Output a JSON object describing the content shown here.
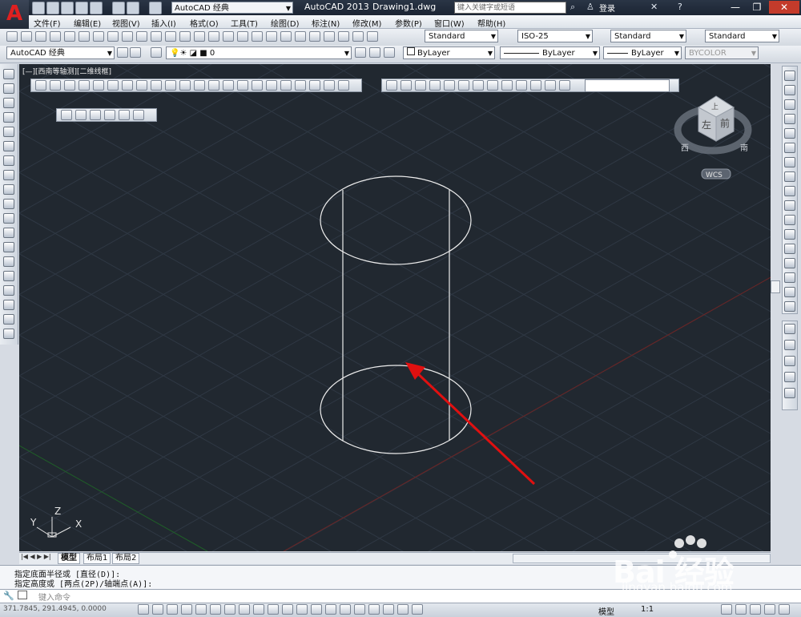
{
  "titlebar": {
    "app_title": "AutoCAD 2013",
    "doc_name": "Drawing1.dwg",
    "workspace": "AutoCAD 经典",
    "search_placeholder": "键入关键字或短语",
    "login": "登录"
  },
  "menu": [
    "文件(F)",
    "编辑(E)",
    "视图(V)",
    "插入(I)",
    "格式(O)",
    "工具(T)",
    "绘图(D)",
    "标注(N)",
    "修改(M)",
    "参数(P)",
    "窗口(W)",
    "帮助(H)"
  ],
  "styles_toolbar": {
    "text_style": "Standard",
    "dim_style": "ISO-25",
    "table_style": "Standard",
    "multileader_style": "Standard"
  },
  "layers_toolbar": {
    "workspace": "AutoCAD 经典",
    "layer": "0",
    "color": "ByLayer",
    "linetype": "ByLayer",
    "lineweight": "ByLayer",
    "plotstyle": "BYCOLOR"
  },
  "viewport": {
    "label": "[—][西南等轴测][二维线框]",
    "viewcube": {
      "top": "上",
      "left": "左",
      "front": "前",
      "south": "南",
      "west": "西"
    },
    "wcs": "WCS",
    "ucs": {
      "x": "X",
      "y": "Y",
      "z": "Z"
    }
  },
  "tabs": [
    "模型",
    "布局1",
    "布局2"
  ],
  "command": {
    "line1": "指定底面半径或 [直径(D)]:",
    "line2": "指定高度或 [两点(2P)/轴端点(A)]:",
    "input_placeholder": "键入命令"
  },
  "status": {
    "coords": "371.7845, 291.4945, 0.0000",
    "model": "模型",
    "scale": "1:1"
  },
  "watermark": {
    "brand": "Bai 经验",
    "url": "jingyan.baidu.com"
  },
  "colors": {
    "canvas": "#212830",
    "arrow": "#e01010",
    "x_axis": "#8a2020",
    "y_axis": "#1f6b2a"
  }
}
